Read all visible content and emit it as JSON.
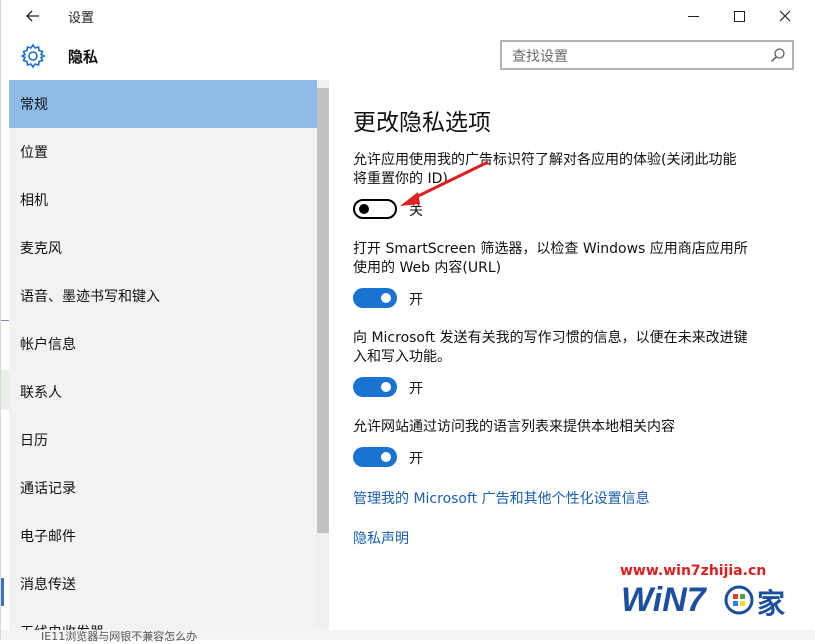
{
  "window": {
    "title": "设置",
    "back_icon": "arrow-left-icon",
    "min_icon": "minimize-icon",
    "max_icon": "maximize-icon",
    "close_icon": "close-icon"
  },
  "header": {
    "icon": "gear-icon",
    "title": "隐私",
    "search_placeholder": "查找设置",
    "search_icon": "search-icon"
  },
  "sidebar": {
    "items": [
      {
        "label": "常规",
        "active": true
      },
      {
        "label": "位置"
      },
      {
        "label": "相机"
      },
      {
        "label": "麦克风"
      },
      {
        "label": "语音、墨迹书写和键入"
      },
      {
        "label": "帐户信息"
      },
      {
        "label": "联系人"
      },
      {
        "label": "日历"
      },
      {
        "label": "通话记录"
      },
      {
        "label": "电子邮件"
      },
      {
        "label": "消息传送"
      },
      {
        "label": "无线电收发器"
      }
    ],
    "active_color": "#8fbbe6"
  },
  "main": {
    "title": "更改隐私选项",
    "settings": [
      {
        "desc_line1": "允许应用使用我的广告标识符了解对各应用的体验(关闭此功能",
        "desc_line2": "将重置你的 ID)",
        "state": "关",
        "on": false
      },
      {
        "desc_line1": "打开 SmartScreen 筛选器，以检查 Windows 应用商店应用所",
        "desc_line2": "使用的 Web 内容(URL)",
        "state": "开",
        "on": true
      },
      {
        "desc_line1": "向 Microsoft 发送有关我的写作习惯的信息，以便在未来改进键",
        "desc_line2": "入和写入功能。",
        "state": "开",
        "on": true
      },
      {
        "desc_line1": "允许网站通过访问我的语言列表来提供本地相关内容",
        "desc_line2": "",
        "state": "开",
        "on": true
      }
    ],
    "links": {
      "manage": "管理我的 Microsoft 广告和其他个性化设置信息",
      "privacy": "隐私声明"
    },
    "toggle_on_color": "#1a73d0",
    "link_color": "#1a5fb4"
  },
  "watermark": {
    "url": "www.win7zhijia.cn",
    "logo_text": "WiN7",
    "logo_suffix": "家"
  },
  "background": {
    "bottom_text": "IE11浏览器与网银不兼容怎么办"
  }
}
